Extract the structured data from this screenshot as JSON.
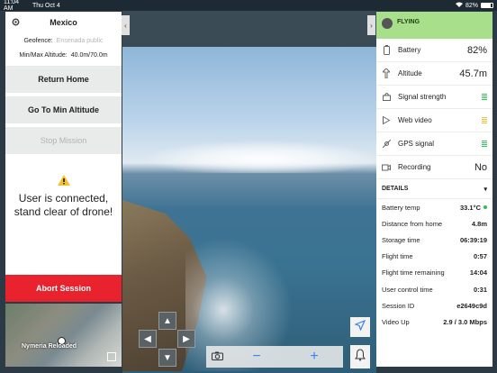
{
  "status_bar": {
    "time": "11:04 AM",
    "date": "Thu Oct 4",
    "battery": "82%",
    "battery_level": 0.82
  },
  "left_panel": {
    "title": "Mexico",
    "geofence_label": "Geofence:",
    "geofence_value": "Ensenada public",
    "altitude_label": "Min/Max Altitude:",
    "altitude_value": "40.0m/70.0m",
    "return_home": "Return Home",
    "go_min_altitude": "Go To Min Altitude",
    "stop_mission": "Stop Mission",
    "warning_message": "User is connected, stand clear of drone!",
    "abort_session": "Abort Session"
  },
  "minimap": {
    "label": "Nymeria Reloaded"
  },
  "right_panel": {
    "state": "FLYING",
    "stats": [
      {
        "label": "Battery",
        "value": "82%",
        "icon": "battery-icon"
      },
      {
        "label": "Altitude",
        "value": "45.7m",
        "icon": "altitude-icon"
      },
      {
        "label": "Signal strength",
        "icon": "signal-icon",
        "status_color": "#34c759"
      },
      {
        "label": "Web video",
        "icon": "play-icon",
        "status_color": "#f2c230"
      },
      {
        "label": "GPS signal",
        "icon": "gps-icon",
        "status_color": "#34c759"
      },
      {
        "label": "Recording",
        "value": "No",
        "icon": "recording-icon"
      }
    ],
    "details_title": "DETAILS",
    "details": [
      {
        "label": "Battery temp",
        "value": "33.1°C"
      },
      {
        "label": "Distance from home",
        "value": "4.8m"
      },
      {
        "label": "Storage time",
        "value": "06:39:19"
      },
      {
        "label": "Flight time",
        "value": "0:57"
      },
      {
        "label": "Flight time remaining",
        "value": "14:04"
      },
      {
        "label": "User control time",
        "value": "0:31"
      },
      {
        "label": "Session ID",
        "value": "e2649c9d"
      },
      {
        "label": "Video Up",
        "value": "2.9 / 3.0 Mbps"
      }
    ]
  },
  "controls": {
    "zoom_out": "−",
    "zoom_in": "+"
  },
  "colors": {
    "abort": "#e8232d",
    "flying": "#a7df8a",
    "accent": "#3b82f6"
  }
}
